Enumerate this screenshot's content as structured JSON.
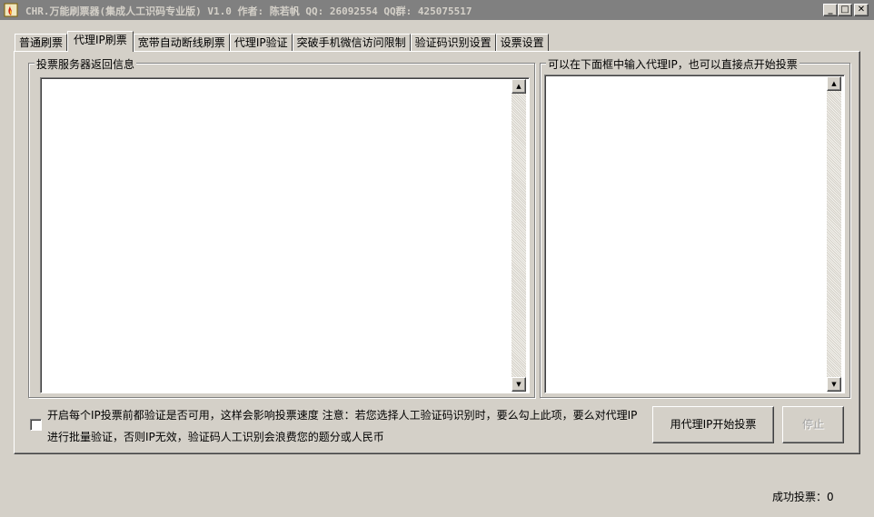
{
  "window": {
    "title": "CHR.万能刷票器(集成人工识码专业版) V1.0 作者: 陈若帆 QQ: 26092554 QQ群: 425075517",
    "min_glyph": "_",
    "max_glyph": "□",
    "close_glyph": "✕"
  },
  "tabs": [
    {
      "label": "普通刷票",
      "active": false
    },
    {
      "label": "代理IP刷票",
      "active": true
    },
    {
      "label": "宽带自动断线刷票",
      "active": false
    },
    {
      "label": "代理IP验证",
      "active": false
    },
    {
      "label": "突破手机微信访问限制",
      "active": false
    },
    {
      "label": "验证码识别设置",
      "active": false
    },
    {
      "label": "设票设置",
      "active": false
    }
  ],
  "left_group": {
    "label": "投票服务器返回信息",
    "content": ""
  },
  "right_group": {
    "label": "可以在下面框中输入代理IP，也可以直接点开始投票",
    "content": ""
  },
  "verify_option": {
    "checked": false,
    "line1": "开启每个IP投票前都验证是否可用，这样会影响投票速度 注意：若您选择人工验证码识别时，要么勾上此项，要么对代理IP",
    "line2": "进行批量验证，否则IP无效，验证码人工识别会浪费您的题分或人民币"
  },
  "buttons": {
    "start_label": "用代理IP开始投票",
    "stop_label": "停止"
  },
  "status": {
    "success_label": "成功投票：",
    "success_count": "0"
  },
  "icons": {
    "app": "app-flame-icon",
    "scroll_up": "▲",
    "scroll_down": "▼"
  }
}
